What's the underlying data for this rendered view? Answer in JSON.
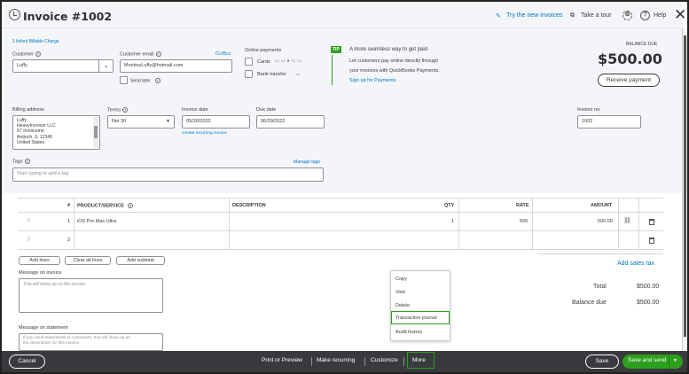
{
  "header": {
    "title": "Invoice #1002",
    "try_new": "Try the new invoices",
    "take_tour": "Take a tour",
    "help": "Help"
  },
  "top": {
    "linked_charge": "1 linked Billable Charge",
    "customer_label": "Customer",
    "customer_value": "Luffy",
    "email_label": "Customer email",
    "email_value": "MonkeyLuffy@hotmail.com",
    "cc_bcc": "Cc/Bcc",
    "send_later": "Send later",
    "online_payments_label": "Online payments",
    "cards_label": "Cards",
    "bank_transfer_label": "Bank transfer",
    "tip_badge": "TIP",
    "tip_title": "A more seamless way to get paid",
    "tip_text_1": "Let customers pay online directly through",
    "tip_text_2": "your invoices with QuickBooks Payments.",
    "tip_link": "Sign up for Payments",
    "balance_due_label": "BALANCE DUE",
    "balance_due_value": "$500.00",
    "receive_payment": "Receive payment"
  },
  "billing": {
    "billing_address_label": "Billing address",
    "address_lines": [
      "Luffy",
      "HeavyInvoicer LLC",
      "67 Invoiceme",
      "Antioch, IL 12345",
      "United States"
    ],
    "terms_label": "Terms",
    "terms_value": "Net 30",
    "invoice_date_label": "Invoice date",
    "invoice_date_value": "05/30/2022",
    "create_recurring": "Create recurring invoice",
    "due_date_label": "Due date",
    "due_date_value": "06/29/2022",
    "invoice_no_label": "Invoice no.",
    "invoice_no_value": "1002",
    "tags_label": "Tags",
    "manage_tags": "Manage tags",
    "tags_placeholder": "Start typing to add a tag"
  },
  "table": {
    "headers": [
      "#",
      "PRODUCT/SERVICE",
      "DESCRIPTION",
      "QTY",
      "RATE",
      "AMOUNT"
    ],
    "rows": [
      {
        "num": "1",
        "product": "iOS Pro Max Ultra",
        "description": "",
        "qty": "1",
        "rate": "500",
        "amount": "500.00"
      },
      {
        "num": "2",
        "product": "",
        "description": "",
        "qty": "",
        "rate": "",
        "amount": ""
      }
    ]
  },
  "actions": {
    "add_lines": "Add lines",
    "clear_all_lines": "Clear all lines",
    "add_subtotal": "Add subtotal",
    "message_invoice_label": "Message on invoice",
    "message_invoice_placeholder": "This will show up on the invoice.",
    "message_statement_label": "Message on statement",
    "message_statement_placeholder_1": "If you send statements to customers, this will show up as",
    "message_statement_placeholder_2": "the description for this invoice."
  },
  "totals": {
    "add_sales_tax": "Add sales tax",
    "total_label": "Total",
    "total_value": "$500.00",
    "balance_due_label": "Balance due",
    "balance_due_value": "$500.00"
  },
  "more_menu": {
    "items": [
      "Copy",
      "Void",
      "Delete",
      "Transaction journal",
      "Audit history"
    ],
    "highlighted": "Transaction journal"
  },
  "footer": {
    "cancel": "Cancel",
    "print_preview": "Print or Preview",
    "make_recurring": "Make recurring",
    "customize": "Customize",
    "more": "More",
    "save": "Save",
    "save_and_send": "Save and send"
  },
  "colors": {
    "accent_green": "#2ca01c",
    "link_blue": "#0077c5",
    "footer_bg": "#393a3d",
    "page_bg": "#f4f5f8"
  }
}
